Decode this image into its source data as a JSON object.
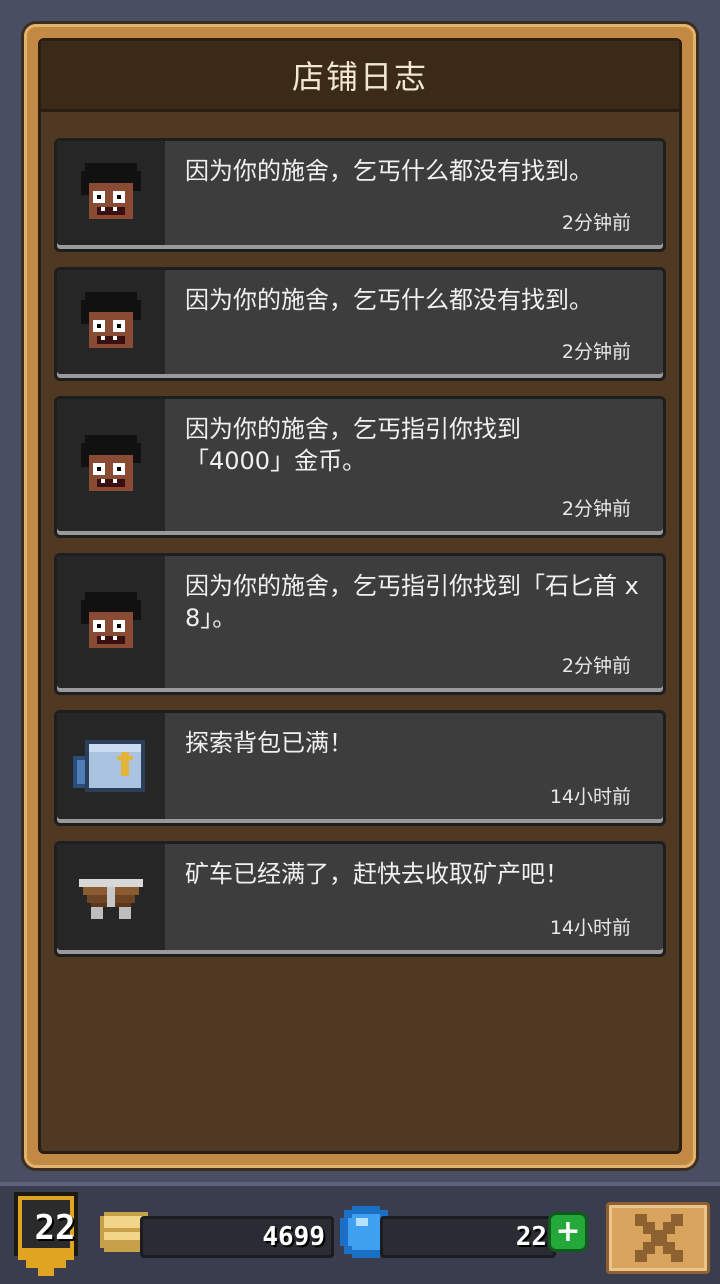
{
  "title": "店铺日志",
  "logs": [
    {
      "icon": "beggar-icon",
      "text": "因为你的施舍，乞丐什么都没有找到。",
      "time": "2分钟前"
    },
    {
      "icon": "beggar-icon",
      "text": "因为你的施舍，乞丐什么都没有找到。",
      "time": "2分钟前"
    },
    {
      "icon": "beggar-icon",
      "text": "因为你的施舍，乞丐指引你找到「4000」金币。",
      "time": "2分钟前"
    },
    {
      "icon": "beggar-icon",
      "text": "因为你的施舍，乞丐指引你找到「石匕首 x 8」。",
      "time": "2分钟前"
    },
    {
      "icon": "backpack-icon",
      "text": "探索背包已满！",
      "time": "14小时前"
    },
    {
      "icon": "minecart-icon",
      "text": "矿车已经满了，赶快去收取矿产吧！",
      "time": "14小时前"
    }
  ],
  "bottom": {
    "level": "22",
    "coins": "4699",
    "gems": "22",
    "plus_label": "+"
  },
  "colors": {
    "panel_frame": "#c28a45",
    "panel_bg": "#4f3922",
    "log_bg": "#3d3d3d",
    "gem_blue": "#3fa1f0",
    "plus_green": "#24a83a"
  }
}
